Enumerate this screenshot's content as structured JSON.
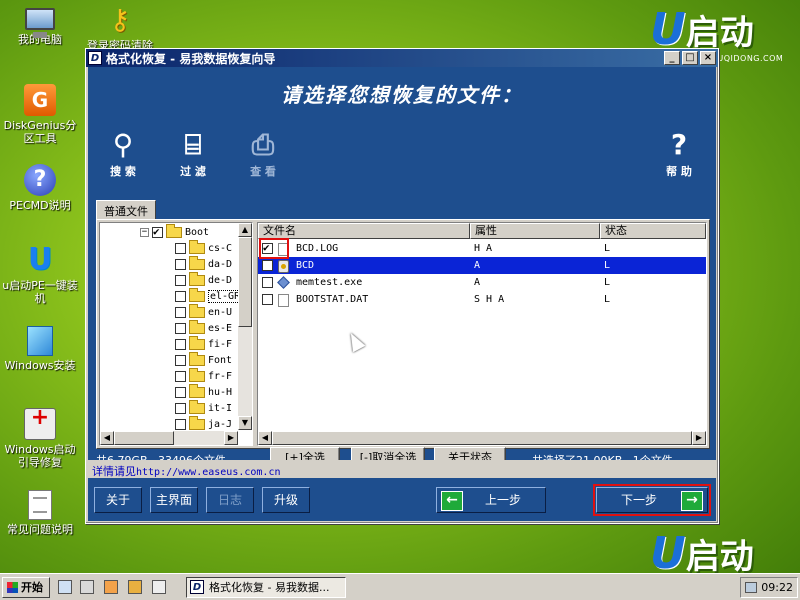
{
  "desktop": {
    "icons": [
      {
        "label": "我的电脑",
        "icon": "computer-icon"
      },
      {
        "label": "DiskGenius分区工具",
        "icon": "diskgenius-icon"
      },
      {
        "label": "PECMD说明",
        "icon": "help-icon"
      },
      {
        "label": "u启动PE一键装机",
        "icon": "u-install-icon"
      },
      {
        "label": "Windows安装",
        "icon": "windows-setup-icon"
      },
      {
        "label": "Windows启动引导修复",
        "icon": "repair-kit-icon"
      },
      {
        "label": "常见问题说明",
        "icon": "document-icon"
      },
      {
        "label": "登录密码清除",
        "icon": "key-icon"
      }
    ],
    "brand": {
      "letter": "U",
      "text": "启动",
      "url": "WWW.UQIDONG.COM"
    }
  },
  "window": {
    "app_icon": "D",
    "title": "格式化恢复 - 易我数据恢复向导",
    "controls": [
      "_",
      "□",
      "×"
    ],
    "heading": "请选择您想恢复的文件：",
    "toolbar": [
      {
        "label": "搜 索",
        "icon": "search-icon",
        "glyph": "🔍"
      },
      {
        "label": "过 滤",
        "icon": "filter-icon",
        "glyph": "⌨"
      },
      {
        "label": "查 看",
        "icon": "view-icon",
        "glyph": "🔎"
      },
      {
        "label": "帮 助",
        "icon": "help-icon",
        "glyph": "?"
      }
    ],
    "tab": "普通文件",
    "tree": {
      "root": "Boot",
      "items": [
        "cs-C",
        "da-D",
        "de-D",
        "el-GR",
        "en-U",
        "es-E",
        "fi-F",
        "Font",
        "fr-F",
        "hu-H",
        "it-I",
        "ja-J"
      ]
    },
    "list": {
      "columns": [
        "文件名",
        "属性",
        "状态"
      ],
      "rows": [
        {
          "name": "BCD.LOG",
          "attr": "H A",
          "status": "L",
          "checked": true
        },
        {
          "name": "BCD",
          "attr": "A",
          "status": "L",
          "checked": false
        },
        {
          "name": "memtest.exe",
          "attr": "A",
          "status": "L",
          "checked": false
        },
        {
          "name": "BOOTSTAT.DAT",
          "attr": "S H A",
          "status": "L",
          "checked": false
        }
      ]
    },
    "status": {
      "total": "共6.79GB , 33496个文件。",
      "select_all": "[+]全选",
      "deselect_all": "[-]取消全选",
      "about_status": "关于状态",
      "selected": "共选择了21.00KB , 1个文件。"
    },
    "link": {
      "label": "详情请见",
      "url": "http://www.easeus.com.cn"
    },
    "nav": {
      "about": "关于",
      "main": "主界面",
      "log": "日志",
      "upgrade": "升级",
      "back": "上一步",
      "next": "下一步",
      "back_arrow": "←",
      "next_arrow": "→"
    }
  },
  "taskbar": {
    "start": "开始",
    "task": "格式化恢复 - 易我数据...",
    "task_icon": "D",
    "clock": "09:22"
  },
  "colors": {
    "window_blue": "#1e4e8e",
    "selection": "#0a24d6",
    "highlight_red": "#e01010",
    "arrow_green": "#1faa3a"
  }
}
